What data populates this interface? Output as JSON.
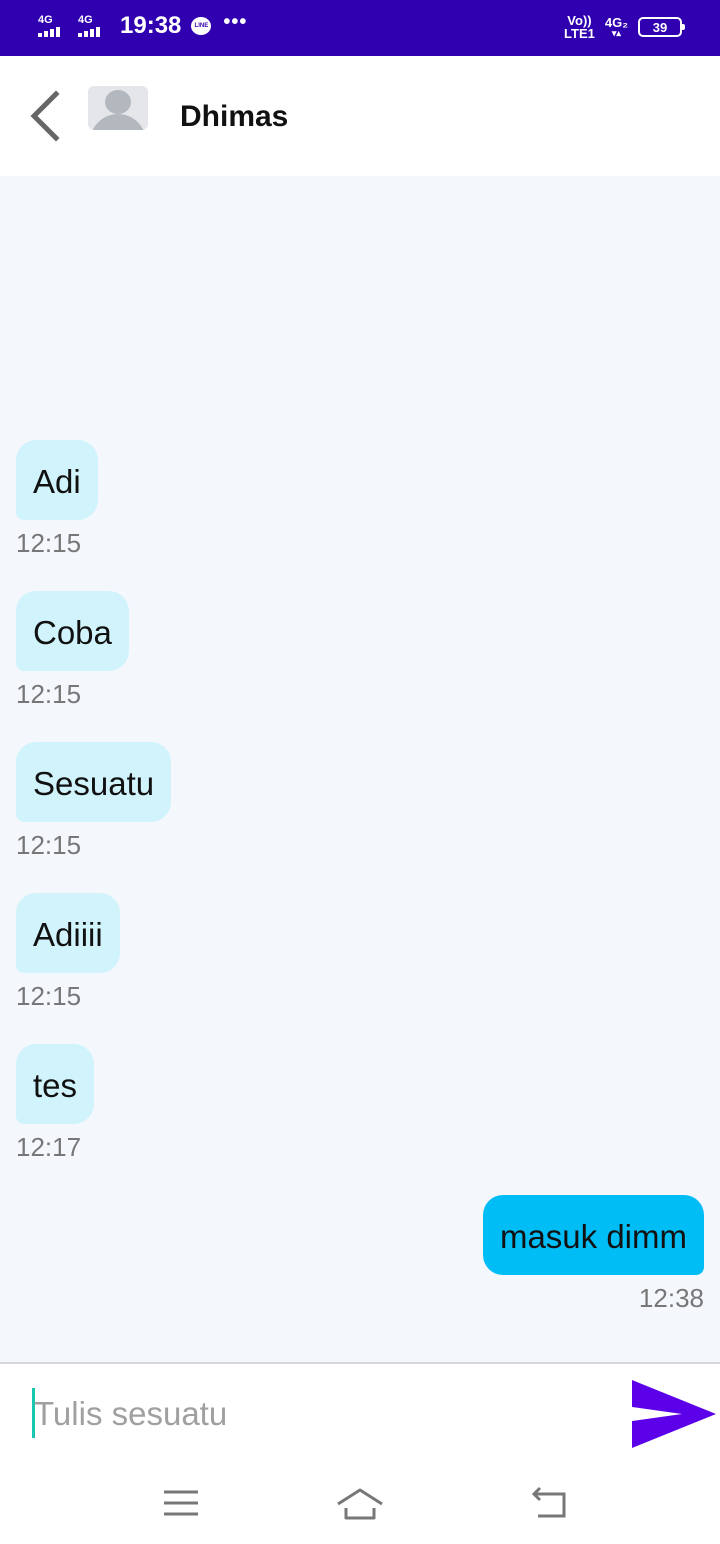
{
  "status_bar": {
    "signal1_label": "4G",
    "signal2_label": "4G",
    "time": "19:38",
    "line_icon_text": "LINE",
    "more": "•••",
    "volte_top": "Vo))",
    "volte_bottom": "LTE1",
    "net_top": "4G₂",
    "net_bottom": "▾▴",
    "battery": "39"
  },
  "header": {
    "contact_name": "Dhimas"
  },
  "messages": [
    {
      "text": "Adi",
      "time": "12:15",
      "direction": "in"
    },
    {
      "text": "Coba",
      "time": "12:15",
      "direction": "in"
    },
    {
      "text": "Sesuatu",
      "time": "12:15",
      "direction": "in"
    },
    {
      "text": "Adiiii",
      "time": "12:15",
      "direction": "in"
    },
    {
      "text": "tes",
      "time": "12:17",
      "direction": "in"
    },
    {
      "text": "masuk dimm",
      "time": "12:38",
      "direction": "out"
    }
  ],
  "input": {
    "placeholder": "Tulis sesuatu",
    "value": ""
  },
  "colors": {
    "status_bar": "#3000b0",
    "incoming_bubble": "#d1f3fc",
    "outgoing_bubble": "#00bdf6",
    "send_icon": "#5b00e8",
    "chat_background": "#f4f8fd"
  },
  "icons": {
    "back": "chevron-left-icon",
    "avatar": "person-avatar-icon",
    "send": "send-arrow-icon",
    "nav_menu": "menu-icon",
    "nav_home": "home-icon",
    "nav_back": "back-return-icon"
  }
}
